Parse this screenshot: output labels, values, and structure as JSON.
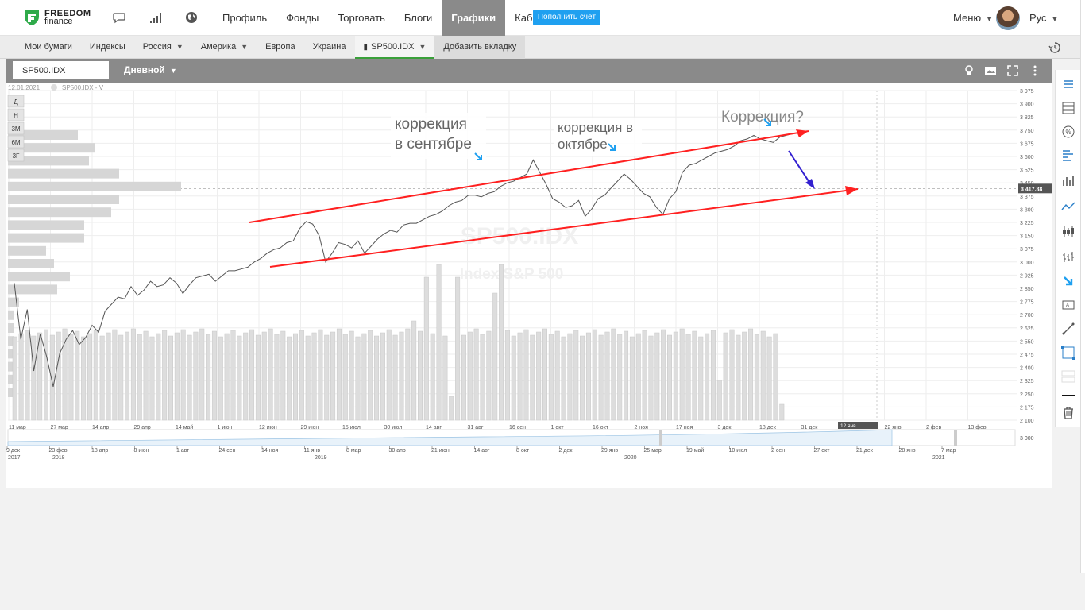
{
  "brand": {
    "name_top": "FREEDOM",
    "name_bottom": "finance"
  },
  "nav": {
    "items": [
      "Профиль",
      "Фонды",
      "Торговать",
      "Блоги",
      "Графики",
      "Кабинет"
    ],
    "active": "Графики"
  },
  "topup_label": "Пополнить счёт",
  "menu_label": "Меню",
  "lang_label": "Рус",
  "tabs": [
    "Мои бумаги",
    "Индексы",
    "Россия",
    "Америка",
    "Европа",
    "Украина",
    "SP500.IDX",
    "Добавить вкладку"
  ],
  "symbol_value": "SP500.IDX",
  "period_label": "Дневной",
  "chart_info": {
    "date": "12.01.2021",
    "series_label": "SP500.IDX - V"
  },
  "period_buttons": [
    "Д",
    "Н",
    "3М",
    "6М",
    "3Г"
  ],
  "watermark": {
    "ticker": "SP500.IDX",
    "name": "Index S&P 500"
  },
  "current_price": "3 417.88",
  "annotations": [
    "коррекция",
    "в сентябре",
    "коррекция в",
    "октябре",
    "Коррекция?"
  ],
  "colors": {
    "accent": "#1fa0f0",
    "trend": "#ff2020",
    "forecast_arrow": "#3320d0",
    "toolbar": "#8a8a8a",
    "active_tab": "#3aa03a"
  },
  "chart_data": {
    "type": "line",
    "y_ticks": [
      "3 975",
      "3 900",
      "3 825",
      "3 750",
      "3 675",
      "3 600",
      "3 525",
      "3 450",
      "3 375",
      "3 300",
      "3 225",
      "3 150",
      "3 075",
      "3 000",
      "2 925",
      "2 850",
      "2 775",
      "2 700",
      "2 625",
      "2 550",
      "2 475",
      "2 400",
      "2 325",
      "2 250",
      "2 175",
      "2 100"
    ],
    "ylim": [
      2100,
      3975
    ],
    "x_ticks": [
      "11 мар",
      "27 мар",
      "14 апр",
      "29 апр",
      "14 май",
      "1 июн",
      "12 июн",
      "29 июн",
      "15 июл",
      "30 июл",
      "14 авг",
      "31 авг",
      "16 сен",
      "1 окт",
      "16 окт",
      "2 ноя",
      "17 ноя",
      "3 дек",
      "18 дек",
      "31 дек",
      "12 янв",
      "22 янв",
      "2 фев",
      "13 фев"
    ],
    "x_years": {
      "first": "2020",
      "second": "2021"
    },
    "date_highlight": "12 янв",
    "price": [
      2880,
      2560,
      2730,
      2380,
      2590,
      2460,
      2290,
      2480,
      2560,
      2610,
      2530,
      2570,
      2640,
      2600,
      2720,
      2760,
      2800,
      2790,
      2860,
      2810,
      2840,
      2890,
      2860,
      2870,
      2910,
      2880,
      2820,
      2870,
      2910,
      2920,
      2930,
      2890,
      2920,
      2950,
      2950,
      2960,
      2970,
      3000,
      3020,
      3050,
      3070,
      3080,
      3110,
      3120,
      3190,
      3230,
      3215,
      3150,
      3000,
      3050,
      3110,
      3100,
      3080,
      3120,
      3050,
      3090,
      3130,
      3160,
      3180,
      3170,
      3210,
      3220,
      3220,
      3240,
      3260,
      3270,
      3290,
      3320,
      3340,
      3350,
      3380,
      3380,
      3370,
      3390,
      3400,
      3430,
      3450,
      3460,
      3480,
      3500,
      3580,
      3510,
      3440,
      3360,
      3340,
      3310,
      3320,
      3350,
      3260,
      3300,
      3360,
      3380,
      3420,
      3460,
      3500,
      3470,
      3430,
      3390,
      3370,
      3310,
      3270,
      3360,
      3400,
      3510,
      3550,
      3560,
      3580,
      3600,
      3620,
      3630,
      3640,
      3660,
      3690,
      3700,
      3720,
      3700,
      3690,
      3680,
      3710,
      3720,
      3730
    ],
    "volume_bars": 124,
    "navigator_ticks": [
      "9 дек",
      "23 фев",
      "18 апр",
      "8 июн",
      "1 авг",
      "24 сен",
      "14 ноя",
      "11 янв",
      "8 мар",
      "30 апр",
      "21 июн",
      "14 авг",
      "8 окт",
      "2 дек",
      "29 янв",
      "25 мар",
      "19 май",
      "10 июл",
      "2 сен",
      "27 окт",
      "21 дек",
      "28 янв",
      "7 мар"
    ],
    "navigator_years": [
      "2017",
      "2018",
      "2019",
      "2020",
      "2021"
    ],
    "navigator_y": "3 000",
    "grid": true
  }
}
